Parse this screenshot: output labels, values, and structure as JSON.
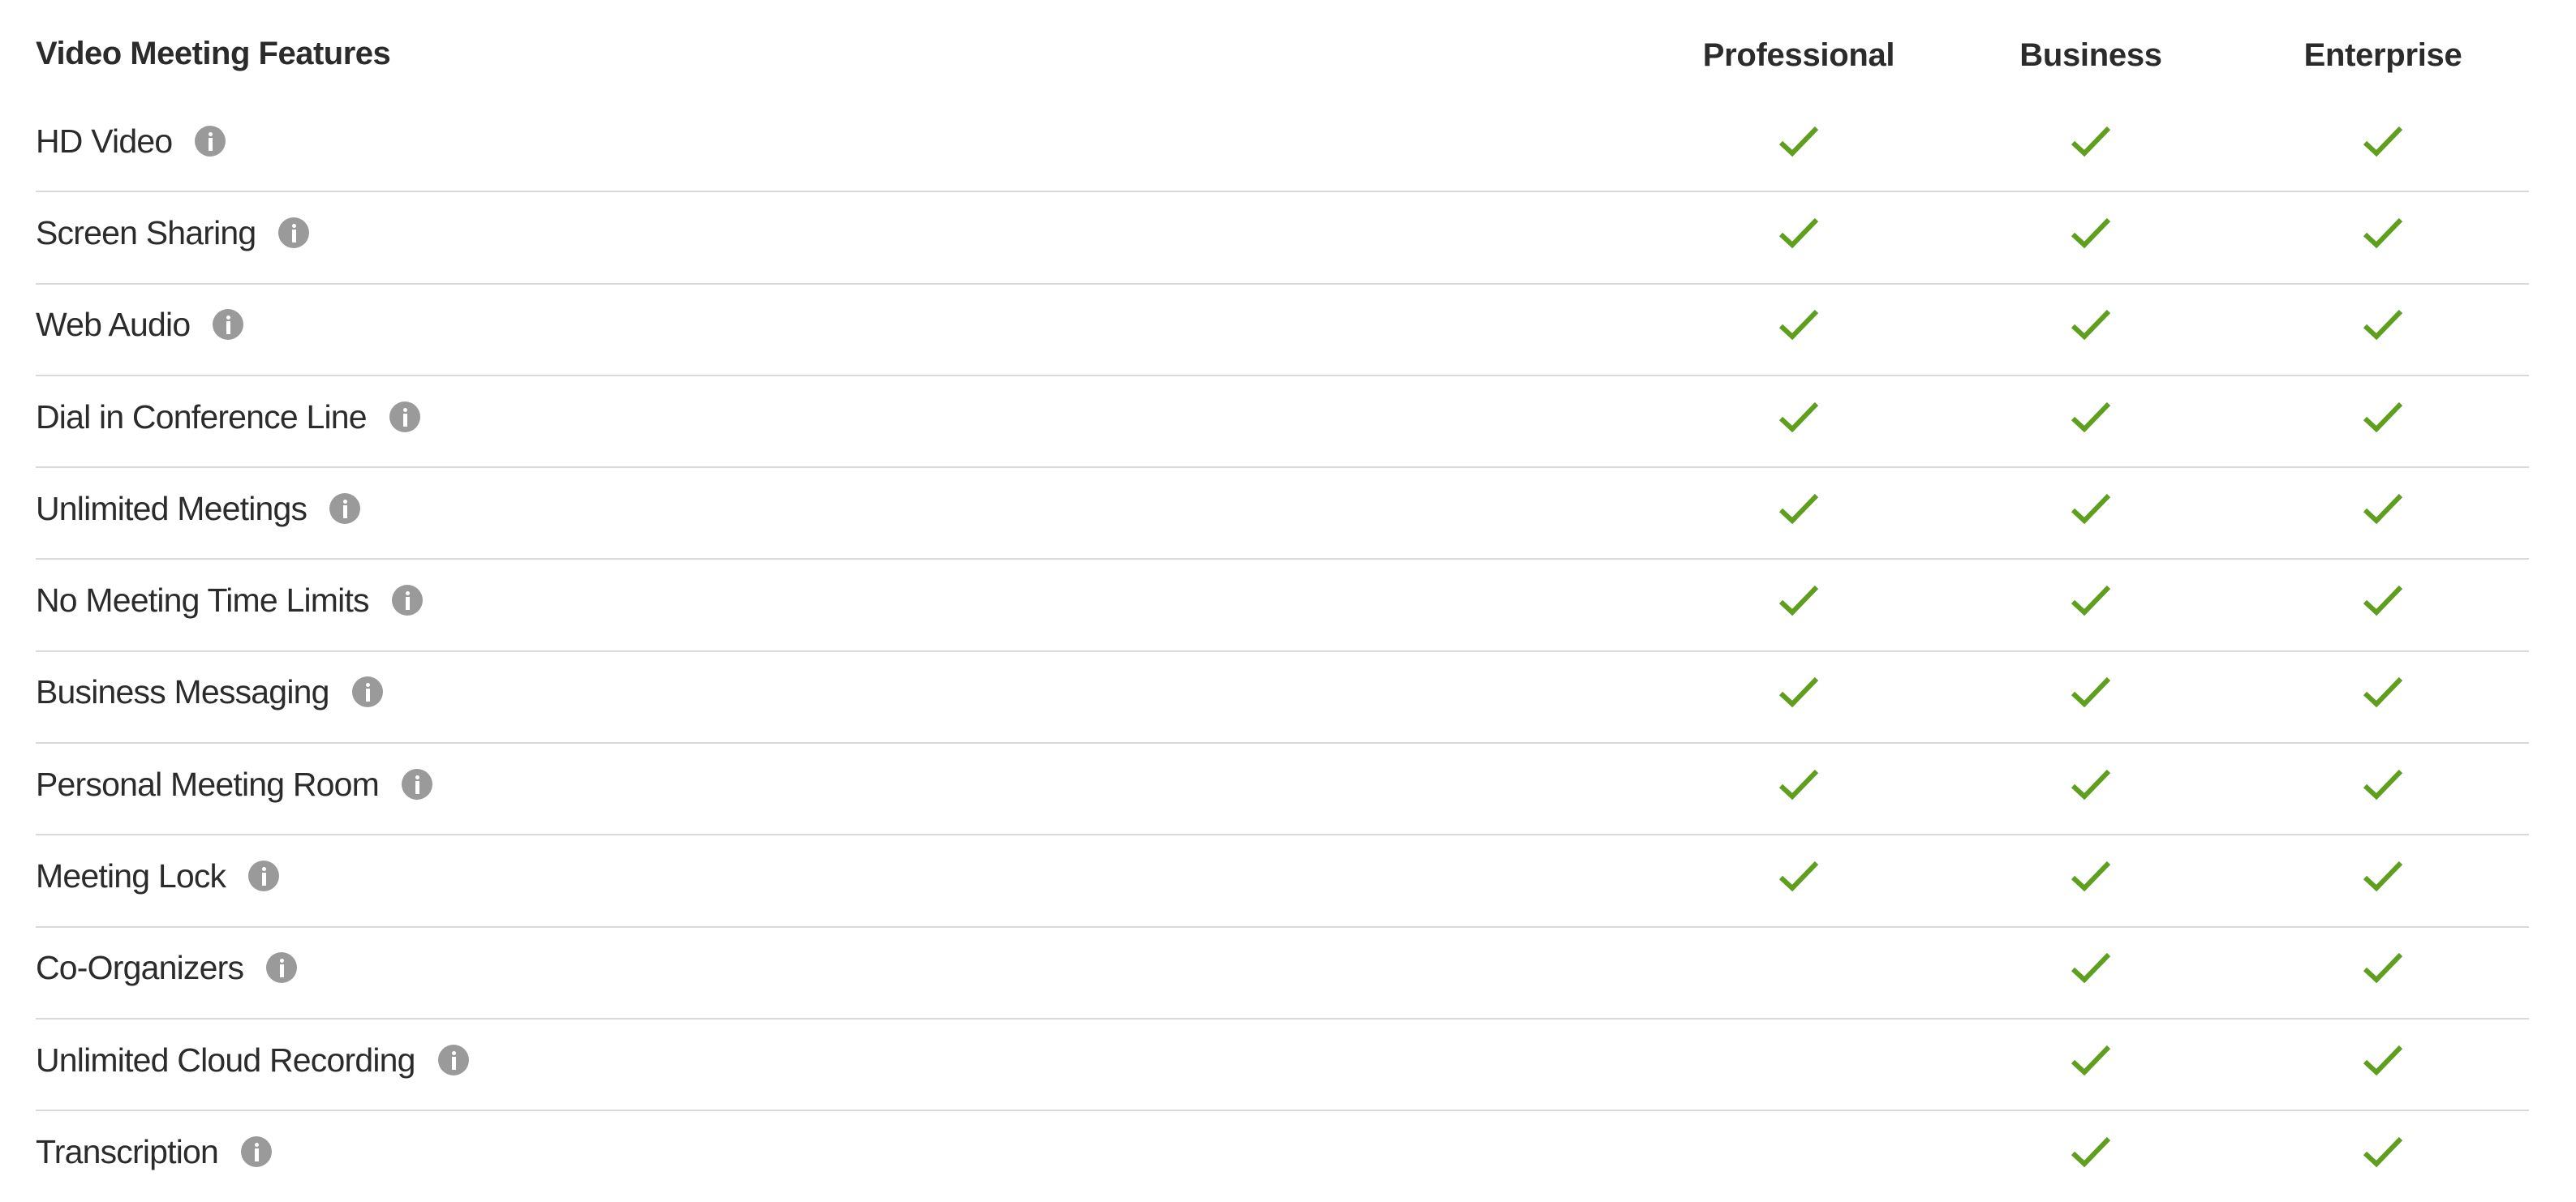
{
  "header": {
    "title": "Video Meeting Features",
    "plans": [
      "Professional",
      "Business",
      "Enterprise"
    ]
  },
  "colors": {
    "check": "#5ea01e",
    "info_icon": "#9a9a9a",
    "divider": "#d9d9d9",
    "text": "#2b2b2b"
  },
  "features": [
    {
      "label": "HD Video",
      "icon": "info-icon",
      "included": [
        true,
        true,
        true
      ]
    },
    {
      "label": "Screen Sharing",
      "icon": "info-icon",
      "included": [
        true,
        true,
        true
      ]
    },
    {
      "label": "Web Audio",
      "icon": "info-icon",
      "included": [
        true,
        true,
        true
      ]
    },
    {
      "label": "Dial in Conference Line",
      "icon": "info-icon",
      "included": [
        true,
        true,
        true
      ]
    },
    {
      "label": "Unlimited Meetings",
      "icon": "info-icon",
      "included": [
        true,
        true,
        true
      ]
    },
    {
      "label": "No Meeting Time Limits",
      "icon": "info-icon",
      "included": [
        true,
        true,
        true
      ]
    },
    {
      "label": "Business Messaging",
      "icon": "info-icon",
      "included": [
        true,
        true,
        true
      ]
    },
    {
      "label": "Personal Meeting Room",
      "icon": "info-icon",
      "included": [
        true,
        true,
        true
      ]
    },
    {
      "label": "Meeting Lock",
      "icon": "info-icon",
      "included": [
        true,
        true,
        true
      ]
    },
    {
      "label": "Co-Organizers",
      "icon": "info-icon",
      "included": [
        false,
        true,
        true
      ]
    },
    {
      "label": "Unlimited Cloud Recording",
      "icon": "info-icon",
      "included": [
        false,
        true,
        true
      ]
    },
    {
      "label": "Transcription",
      "icon": "info-icon",
      "included": [
        false,
        true,
        true
      ]
    }
  ]
}
